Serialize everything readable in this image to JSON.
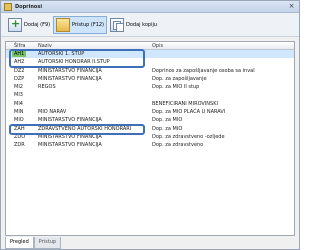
{
  "window": {
    "title": "Doprinosi",
    "close_glyph": "×"
  },
  "toolbar": {
    "add_label": "Dodaj (F9)",
    "browse_label": "Pristup (F12)",
    "copy_label": "Dodaj kopiju"
  },
  "grid": {
    "columns": {
      "sifra": "Šifra",
      "naziv": "Naziv",
      "opis": "Opis"
    },
    "rows": [
      {
        "sifra": "AH1",
        "naziv": "AUTORSKI 1. STUP",
        "opis": ""
      },
      {
        "sifra": "AH2",
        "naziv": "AUTORSKI HONORAR II.STUP",
        "opis": ""
      },
      {
        "sifra": "DZ2",
        "naziv": "MINISTARSTVO FINANCIJA",
        "opis": "Doprinos za zapošljavanje osoba sa inval"
      },
      {
        "sifra": "DZP",
        "naziv": "MINISTARSTVO FINANCIJA",
        "opis": "Dop. za zapošljavanje"
      },
      {
        "sifra": "MI2",
        "naziv": "REGOS",
        "opis": "Dop. za MIO II stup"
      },
      {
        "sifra": "MI3",
        "naziv": "",
        "opis": ""
      },
      {
        "sifra": "MI4",
        "naziv": "",
        "opis": "BENEFICIRANI MIROVINSKI"
      },
      {
        "sifra": "MIN",
        "naziv": "MIO NARAV",
        "opis": "Dop. za MIO PLAĆA U NARAVI"
      },
      {
        "sifra": "MIO",
        "naziv": "MINISTARSTVO FINANCIJA",
        "opis": "Dop. za MIO"
      },
      {
        "sifra": "ZAH",
        "naziv": "ZDRAVSTVENO AUTORSKI HONORARI",
        "opis": "Dop. za MIO"
      },
      {
        "sifra": "ZDO",
        "naziv": "MINISTARSTVO FINANCIJA",
        "opis": "Dop. za zdravstveno -ozljede"
      },
      {
        "sifra": "ZDR",
        "naziv": "MINISTARSTVO FINANCIJA",
        "opis": "Dop. za zdravstveno"
      }
    ]
  },
  "tabs": [
    {
      "label": "Pregled"
    },
    {
      "label": "Pristup"
    }
  ],
  "colors": {
    "highlight": "#3f6fb8",
    "selected_cell": "#77c36a"
  }
}
